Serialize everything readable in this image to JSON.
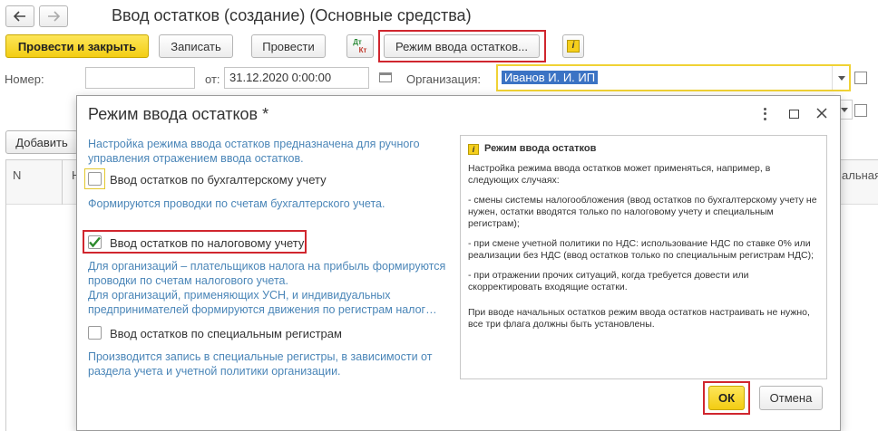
{
  "window": {
    "title": "Ввод остатков (создание) (Основные средства)"
  },
  "toolbar": {
    "post_close_label": "Провести и закрыть",
    "save_label": "Записать",
    "post_label": "Провести",
    "dtkt_top": "Дт",
    "dtkt_bottom": "Кт",
    "mode_label": "Режим ввода остатков...",
    "info_icon": "i"
  },
  "form": {
    "number_label": "Номер:",
    "number_value": "",
    "date_label": "от:",
    "date_value": "31.12.2020  0:00:00",
    "org_label": "Организация:",
    "org_value": "Иванов И. И. ИП"
  },
  "background": {
    "add_label": "Добавить",
    "col_n": "N",
    "col_n2": "Н",
    "col_right": "альная с"
  },
  "dialog": {
    "title": "Режим ввода остатков *",
    "intro": "Настройка режима ввода остатков предназначена для ручного управления отражением  ввода остатков.",
    "opt1_label": "Ввод остатков по бухгалтерскому учету",
    "opt1_checked": false,
    "opt1_hint": "Формируются проводки по счетам бухгалтерского учета.",
    "opt2_label": "Ввод остатков по налоговому учету",
    "opt2_checked": true,
    "opt2_hint": "Для организаций – плательщиков налога на прибыль формируются проводки по счетам налогового учета.\nДля организаций, применяющих УСН, и  индивидуальных предпринимателей формируются движения по регистрам налог…",
    "opt3_label": "Ввод остатков по специальным регистрам",
    "opt3_checked": false,
    "opt3_hint": "Производится запись в специальные регистры, в зависимости от раздела учета и учетной политики организации.",
    "info_title": "Режим ввода остатков",
    "info_paragraphs": [
      "Настройка режима ввода остатков может применяться, например, в следующих случаях:",
      "- смены системы налогообложения (ввод остатков по бухгалтерскому учету не нужен, остатки вводятся только по налоговому учету и специальным регистрам);",
      "- при смене учетной политики по НДС: использование НДС по ставке 0% или реализации без НДС (ввод остатков только по специальным регистрам НДС);",
      "- при отражении прочих ситуаций, когда требуется довести или скорректировать входящие остатки.",
      "При вводе начальных остатков режим ввода остатков настраивать не нужно, все три флага должны быть установлены."
    ],
    "ok_label": "ОК",
    "cancel_label": "Отмена"
  }
}
